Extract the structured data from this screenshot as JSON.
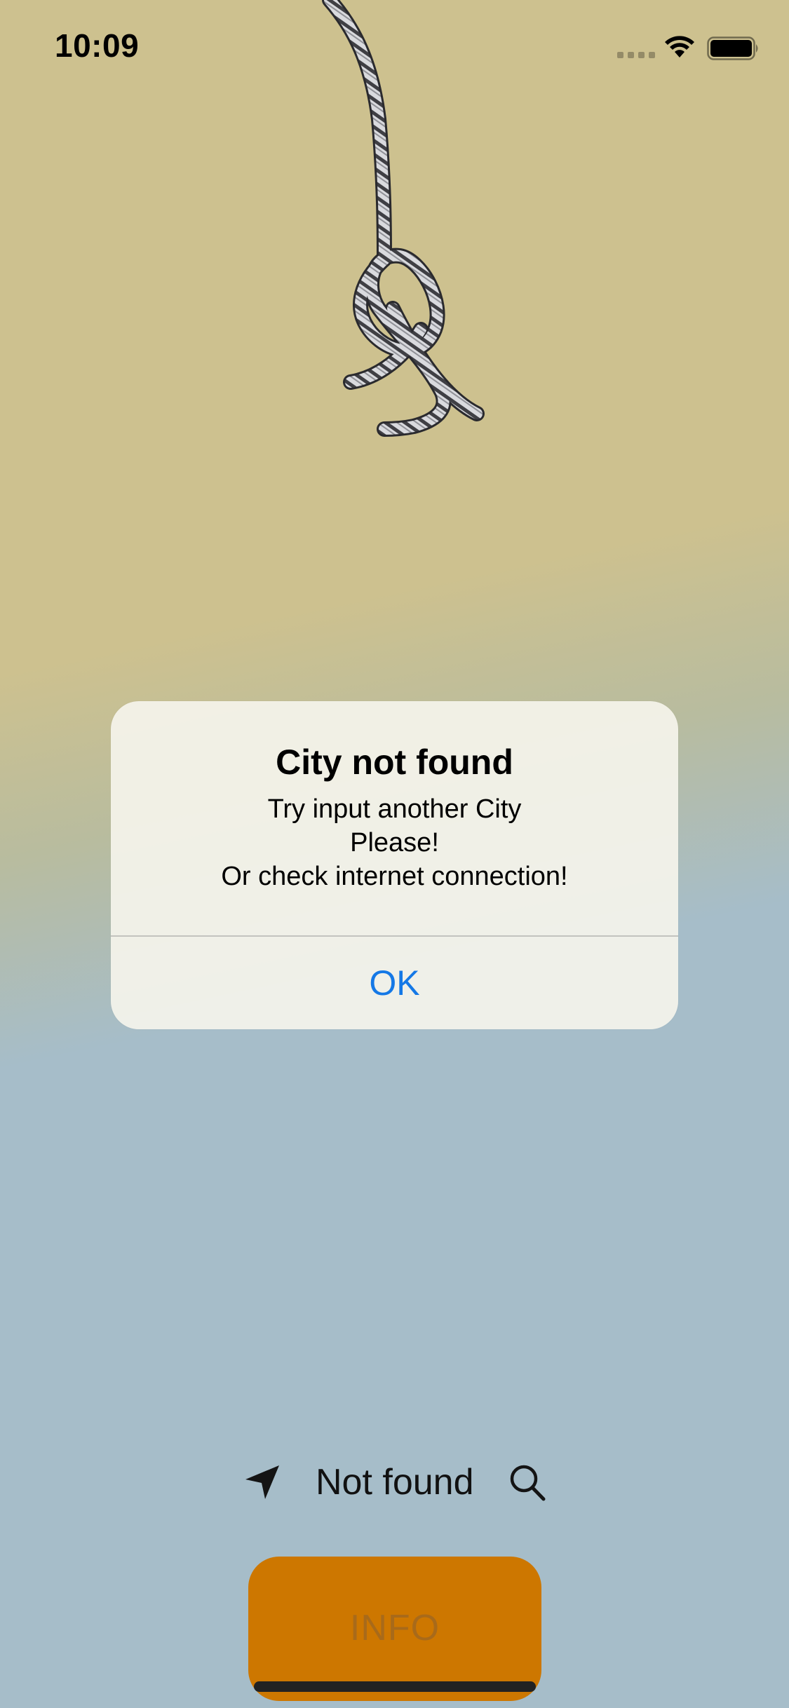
{
  "status_bar": {
    "time": "10:09",
    "icons": [
      "signal-dots-icon",
      "wifi-icon",
      "battery-icon"
    ]
  },
  "illustration": {
    "icon": "rope-knot-icon"
  },
  "alert": {
    "title": "City not found",
    "message_lines": [
      "Try input another City",
      "Please!",
      "Or check internet connection!"
    ],
    "ok_label": "OK",
    "ok_color": "#1478E6"
  },
  "location": {
    "location_icon": "location-arrow-icon",
    "status_text": "Not found",
    "search_icon": "search-icon"
  },
  "info_button": {
    "label": "INFO",
    "color": "#CD7700"
  },
  "colors": {
    "background_top": "#CDC18F",
    "background_bottom": "#A6BDC9"
  }
}
